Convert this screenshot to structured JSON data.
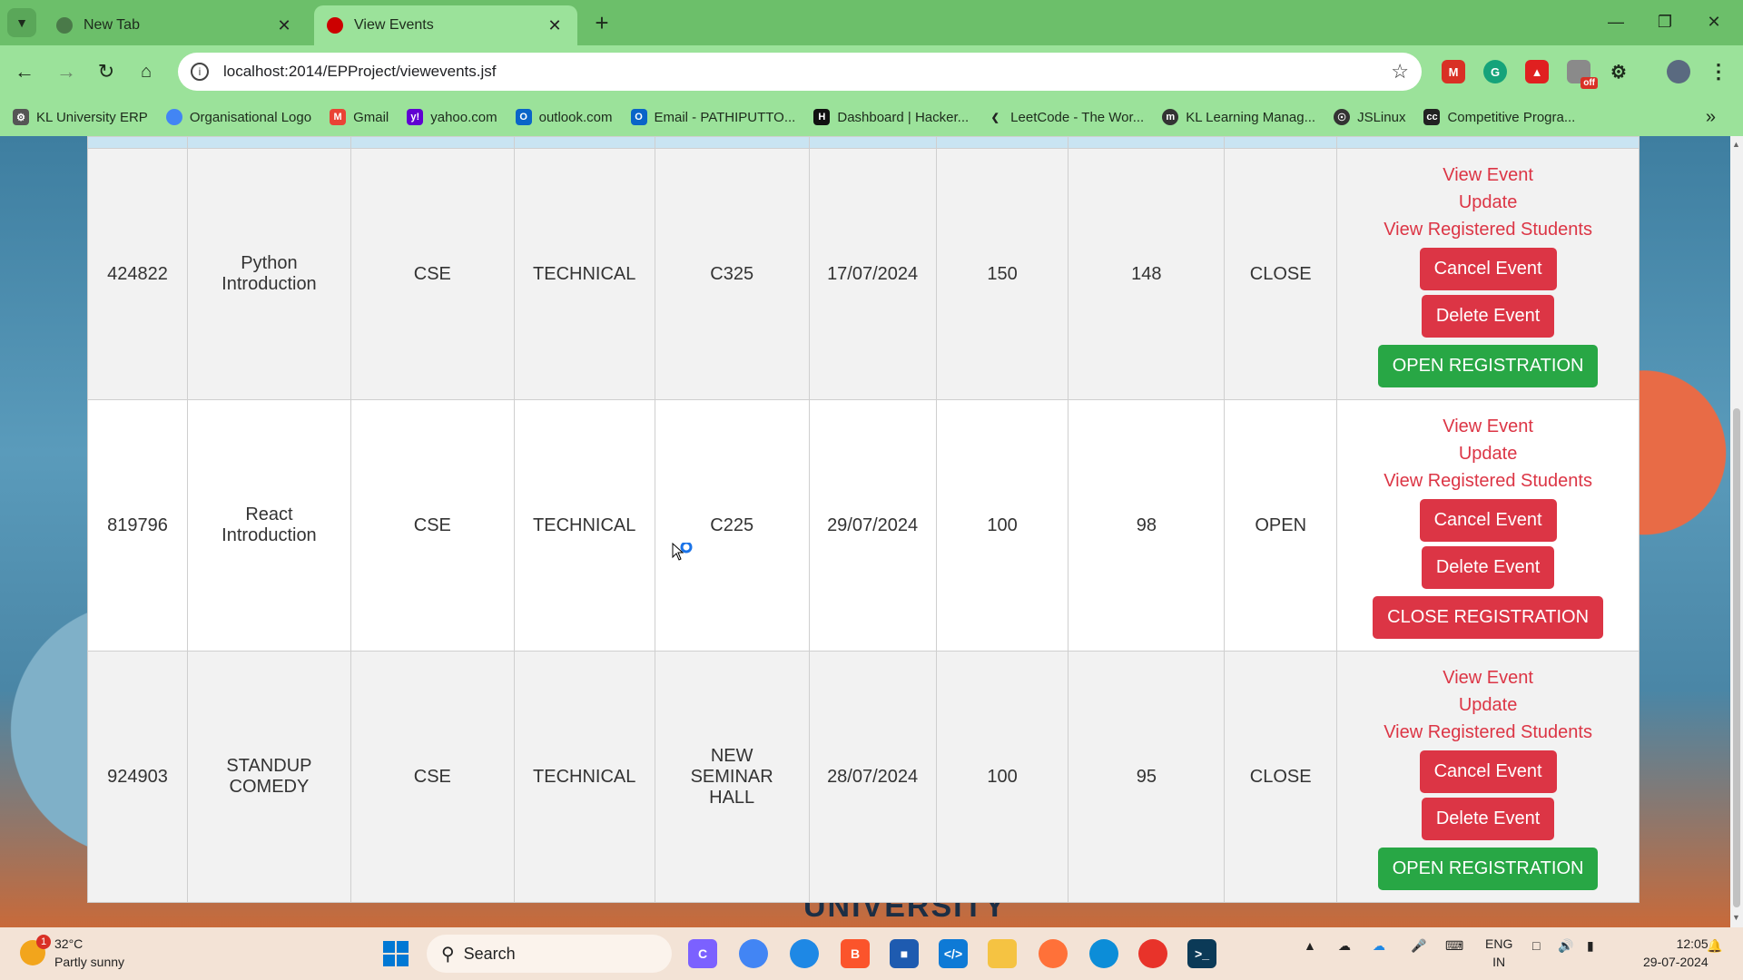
{
  "browser": {
    "tabs": [
      {
        "title": "New Tab"
      },
      {
        "title": "View Events"
      }
    ],
    "url": "localhost:2014/EPProject/viewevents.jsf",
    "bookmarks": [
      "KL University ERP",
      "Organisational Logo",
      "Gmail",
      "yahoo.com",
      "outlook.com",
      "Email - PATHIPUTTO...",
      "Dashboard | Hacker...",
      "LeetCode - The Wor...",
      "KL Learning Manag...",
      "JSLinux",
      "Competitive Progra..."
    ],
    "extension_badge": "off"
  },
  "page": {
    "background_text": "UNIVERSITY",
    "links": {
      "view_event": "View Event",
      "update": "Update",
      "view_registered": "View Registered Students"
    },
    "buttons": {
      "cancel": "Cancel Event",
      "delete": "Delete Event"
    },
    "events": [
      {
        "id": "424822",
        "name": "Python Introduction",
        "dept": "CSE",
        "category": "TECHNICAL",
        "venue": "C325",
        "date": "17/07/2024",
        "capacity": "150",
        "registered": "148",
        "status": "CLOSE",
        "reg_button": "OPEN REGISTRATION",
        "reg_color": "#28a745"
      },
      {
        "id": "819796",
        "name": "React Introduction",
        "dept": "CSE",
        "category": "TECHNICAL",
        "venue": "C225",
        "date": "29/07/2024",
        "capacity": "100",
        "registered": "98",
        "status": "OPEN",
        "reg_button": "CLOSE REGISTRATION",
        "reg_color": "#dc3545"
      },
      {
        "id": "924903",
        "name": "STANDUP COMEDY",
        "dept": "CSE",
        "category": "TECHNICAL",
        "venue": "NEW SEMINAR HALL",
        "date": "28/07/2024",
        "capacity": "100",
        "registered": "95",
        "status": "CLOSE",
        "reg_button": "OPEN REGISTRATION",
        "reg_color": "#28a745"
      }
    ]
  },
  "taskbar": {
    "weather": {
      "temp": "32°C",
      "desc": "Partly sunny",
      "badge": "1"
    },
    "search_placeholder": "Search",
    "lang_1": "ENG",
    "lang_2": "IN",
    "time": "12:05",
    "date": "29-07-2024"
  },
  "colors": {
    "link_red": "#dc3545",
    "button_green": "#28a745",
    "chrome_green": "#6cbf6a"
  }
}
